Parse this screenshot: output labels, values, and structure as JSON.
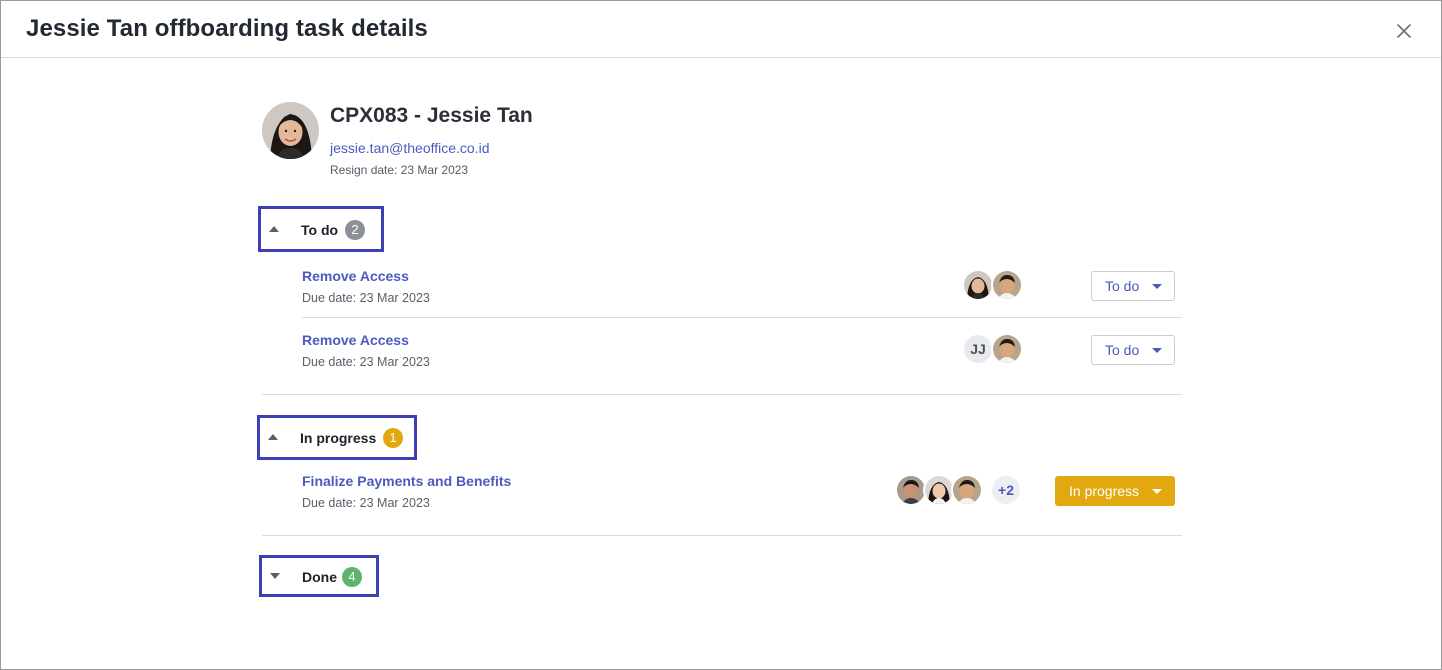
{
  "modal": {
    "title": "Jessie Tan offboarding task details"
  },
  "employee": {
    "name": "CPX083 - Jessie Tan",
    "email": "jessie.tan@theoffice.co.id",
    "resign_date": "Resign date: 23 Mar 2023"
  },
  "sections": {
    "todo": {
      "label": "To do",
      "count": "2",
      "badge_color": "#8c9099",
      "expanded": true,
      "tasks": [
        {
          "title": "Remove Access",
          "due": "Due date: 23 Mar 2023",
          "status": "To do",
          "assignees": [
            "avatar-woman",
            "avatar-man"
          ]
        },
        {
          "title": "Remove Access",
          "due": "Due date: 23 Mar 2023",
          "status": "To do",
          "assignees": [
            "JJ",
            "avatar-man"
          ]
        }
      ]
    },
    "in_progress": {
      "label": "In progress",
      "count": "1",
      "badge_color": "#e2a810",
      "expanded": true,
      "tasks": [
        {
          "title": "Finalize Payments and Benefits",
          "due": "Due date: 23 Mar 2023",
          "status": "In progress",
          "assignees": [
            "avatar-man",
            "avatar-woman",
            "avatar-man"
          ],
          "more": "+2"
        }
      ]
    },
    "done": {
      "label": "Done",
      "count": "4",
      "badge_color": "#5bb56b",
      "expanded": false
    }
  },
  "colors": {
    "accent": "#4a5bbf",
    "highlight_border": "#3d3fb5",
    "in_progress": "#e2a810",
    "done": "#5bb56b"
  }
}
